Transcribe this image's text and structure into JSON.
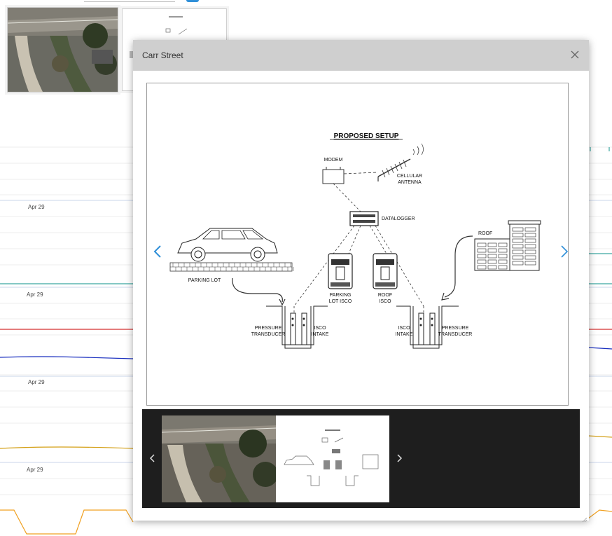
{
  "background": {
    "date_labels": [
      "Apr 29",
      "Apr 29",
      "Apr 29",
      "Apr 29"
    ],
    "series_colors": {
      "teal": "#3aa6a0",
      "red": "#d32f2f",
      "blue": "#1a2fbf",
      "gold": "#d4a017",
      "orange": "#f0a020"
    }
  },
  "modal": {
    "title": "Carr Street",
    "close_icon": "close-icon",
    "prev_icon": "chevron-left-icon",
    "next_icon": "chevron-right-icon"
  },
  "diagram": {
    "title": "PROPOSED SETUP",
    "modem": "MODEM",
    "cellular_antenna": [
      "CELLULAR",
      "ANTENNA"
    ],
    "datalogger": "DATALOGGER",
    "roof": "ROOF",
    "parking_lot": "PARKING LOT",
    "parking_lot_isco": [
      "PARKING",
      "LOT ISCO"
    ],
    "roof_isco": [
      "ROOF",
      "ISCO"
    ],
    "pressure_transducer": [
      "PRESSURE",
      "TRANSDUCER"
    ],
    "isco_intake": [
      "ISCO",
      "INTAKE"
    ]
  },
  "strip": {
    "prev_icon": "chevron-left-icon",
    "next_icon": "chevron-right-icon",
    "thumbnails": [
      "aerial-photo",
      "proposed-setup-diagram"
    ]
  },
  "colors": {
    "accent": "#2f8fd8",
    "header": "#cfcfcf",
    "strip": "#1e1e1e"
  }
}
